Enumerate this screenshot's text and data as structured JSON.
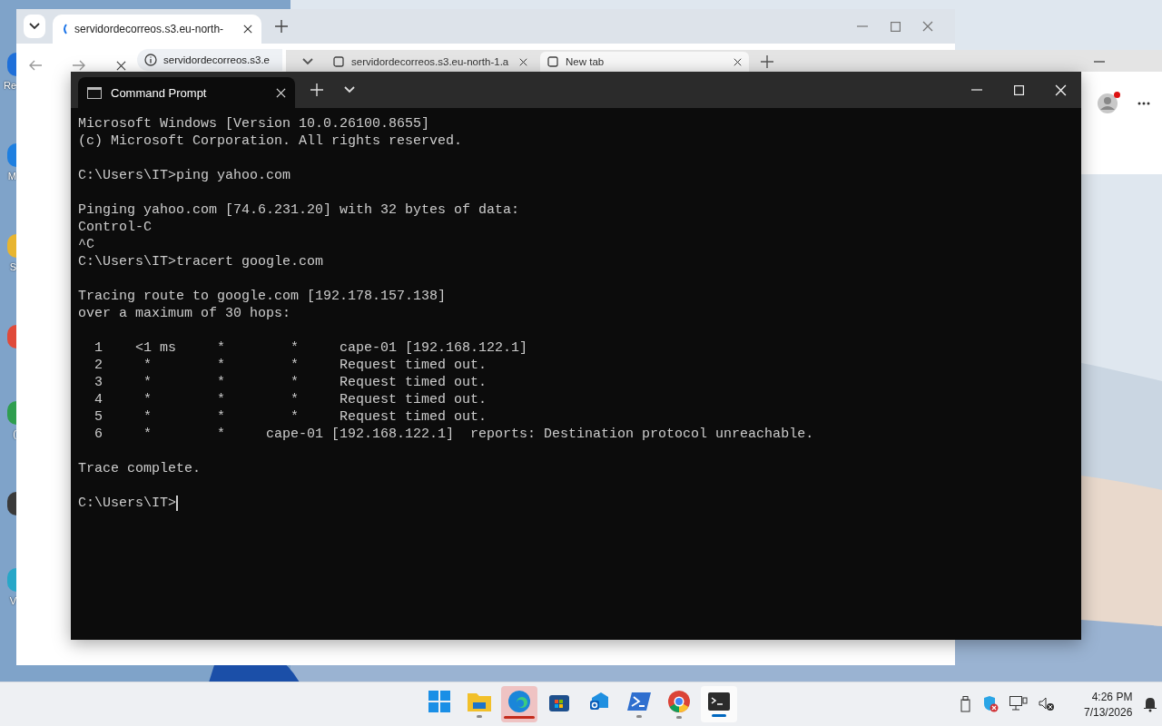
{
  "desktop": {
    "icons": [
      {
        "label": "Re",
        "color": "#1e6fd9"
      },
      {
        "label": "M",
        "color": "#1e7fe0"
      },
      {
        "label": "S",
        "color": "#e8b530"
      },
      {
        "color": "#e04a3a"
      },
      {
        "label": "(",
        "color": "#2f9e4f"
      },
      {
        "color": "#3a3a3a"
      },
      {
        "label": "V",
        "color": "#27a7c8"
      }
    ]
  },
  "chrome": {
    "tab": {
      "title": "servidordecorreos.s3.eu-north-"
    },
    "address": "servidordecorreos.s3.e"
  },
  "edge": {
    "tabs": [
      {
        "title": "servidordecorreos.s3.eu-north-1.a",
        "selected": false
      },
      {
        "title": "New tab",
        "selected": true
      }
    ],
    "profile_alert": true
  },
  "terminal": {
    "tab": {
      "title": "Command Prompt"
    },
    "lines": [
      {
        "kind": "text",
        "text": "Microsoft Windows [Version 10.0.26100.8655]"
      },
      {
        "kind": "text",
        "text": "(c) Microsoft Corporation. All rights reserved."
      },
      {
        "kind": "blank"
      },
      {
        "kind": "text",
        "text": "C:\\Users\\IT>ping yahoo.com"
      },
      {
        "kind": "blank"
      },
      {
        "kind": "text",
        "text": "Pinging yahoo.com [74.6.231.20] with 32 bytes of data:"
      },
      {
        "kind": "text",
        "text": "Control-C"
      },
      {
        "kind": "text",
        "text": "^C"
      },
      {
        "kind": "text",
        "text": "C:\\Users\\IT>tracert google.com"
      },
      {
        "kind": "blank"
      },
      {
        "kind": "text",
        "text": "Tracing route to google.com [192.178.157.138]"
      },
      {
        "kind": "text",
        "text": "over a maximum of 30 hops:"
      },
      {
        "kind": "blank"
      },
      {
        "kind": "text",
        "text": "  1    <1 ms     *        *     cape-01 [192.168.122.1]"
      },
      {
        "kind": "text",
        "text": "  2     *        *        *     Request timed out."
      },
      {
        "kind": "text",
        "text": "  3     *        *        *     Request timed out."
      },
      {
        "kind": "text",
        "text": "  4     *        *        *     Request timed out."
      },
      {
        "kind": "text",
        "text": "  5     *        *        *     Request timed out."
      },
      {
        "kind": "text",
        "text": "  6     *        *     cape-01 [192.168.122.1]  reports: Destination protocol unreachable."
      },
      {
        "kind": "blank"
      },
      {
        "kind": "text",
        "text": "Trace complete."
      },
      {
        "kind": "blank"
      },
      {
        "kind": "prompt",
        "text": "C:\\Users\\IT>"
      }
    ]
  },
  "taskbar": {
    "apps": [
      {
        "kind": "start",
        "running": false,
        "selected": false,
        "attention": false
      },
      {
        "kind": "explorer",
        "running": true,
        "selected": false,
        "attention": false
      },
      {
        "kind": "edge",
        "running": true,
        "selected": false,
        "attention": true
      },
      {
        "kind": "store",
        "running": false,
        "selected": false,
        "attention": false
      },
      {
        "kind": "outlook",
        "running": false,
        "selected": false,
        "attention": false
      },
      {
        "kind": "powershell",
        "running": true,
        "selected": false,
        "attention": false
      },
      {
        "kind": "chrome",
        "running": true,
        "selected": false,
        "attention": false
      },
      {
        "kind": "terminal",
        "running": true,
        "selected": true,
        "attention": false
      }
    ],
    "tray": {
      "time": "4:26 PM",
      "date": "7/13/2026"
    }
  }
}
